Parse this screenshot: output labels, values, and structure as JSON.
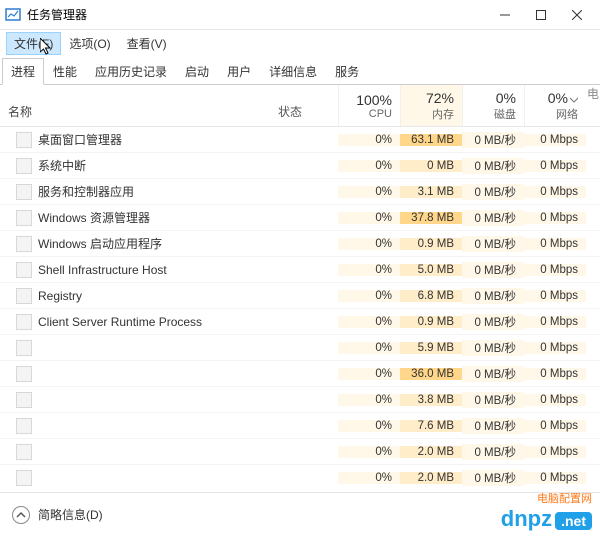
{
  "window": {
    "title": "任务管理器",
    "menus": {
      "file": "文件(F)",
      "options": "选项(O)",
      "view": "查看(V)"
    },
    "tabs": [
      "进程",
      "性能",
      "应用历史记录",
      "启动",
      "用户",
      "详细信息",
      "服务"
    ],
    "headers": {
      "name": "名称",
      "status": "状态",
      "cpu_pct": "100%",
      "cpu_lbl": "CPU",
      "mem_pct": "72%",
      "mem_lbl": "内存",
      "disk_pct": "0%",
      "disk_lbl": "磁盘",
      "net_pct": "0%",
      "net_lbl": "网络",
      "extra": "电"
    }
  },
  "processes": [
    {
      "name": "桌面窗口管理器",
      "cpu": "0%",
      "mem": "63.1 MB",
      "mem_hot": true,
      "disk": "0 MB/秒",
      "net": "0 Mbps"
    },
    {
      "name": "系统中断",
      "cpu": "0%",
      "mem": "0 MB",
      "mem_hot": false,
      "disk": "0 MB/秒",
      "net": "0 Mbps"
    },
    {
      "name": "服务和控制器应用",
      "cpu": "0%",
      "mem": "3.1 MB",
      "mem_hot": false,
      "disk": "0 MB/秒",
      "net": "0 Mbps"
    },
    {
      "name": "Windows 资源管理器",
      "cpu": "0%",
      "mem": "37.8 MB",
      "mem_hot": true,
      "disk": "0 MB/秒",
      "net": "0 Mbps"
    },
    {
      "name": "Windows 启动应用程序",
      "cpu": "0%",
      "mem": "0.9 MB",
      "mem_hot": false,
      "disk": "0 MB/秒",
      "net": "0 Mbps"
    },
    {
      "name": "Shell Infrastructure Host",
      "cpu": "0%",
      "mem": "5.0 MB",
      "mem_hot": false,
      "disk": "0 MB/秒",
      "net": "0 Mbps"
    },
    {
      "name": "Registry",
      "cpu": "0%",
      "mem": "6.8 MB",
      "mem_hot": false,
      "disk": "0 MB/秒",
      "net": "0 Mbps"
    },
    {
      "name": "Client Server Runtime Process",
      "cpu": "0%",
      "mem": "0.9 MB",
      "mem_hot": false,
      "disk": "0 MB/秒",
      "net": "0 Mbps"
    },
    {
      "name": "",
      "cpu": "0%",
      "mem": "5.9 MB",
      "mem_hot": false,
      "disk": "0 MB/秒",
      "net": "0 Mbps"
    },
    {
      "name": "",
      "cpu": "0%",
      "mem": "36.0 MB",
      "mem_hot": true,
      "disk": "0 MB/秒",
      "net": "0 Mbps"
    },
    {
      "name": "",
      "cpu": "0%",
      "mem": "3.8 MB",
      "mem_hot": false,
      "disk": "0 MB/秒",
      "net": "0 Mbps"
    },
    {
      "name": "",
      "cpu": "0%",
      "mem": "7.6 MB",
      "mem_hot": false,
      "disk": "0 MB/秒",
      "net": "0 Mbps"
    },
    {
      "name": "",
      "cpu": "0%",
      "mem": "2.0 MB",
      "mem_hot": false,
      "disk": "0 MB/秒",
      "net": "0 Mbps"
    },
    {
      "name": "",
      "cpu": "0%",
      "mem": "2.0 MB",
      "mem_hot": false,
      "disk": "0 MB/秒",
      "net": "0 Mbps"
    }
  ],
  "footer": {
    "fewer_details": "简略信息(D)"
  },
  "watermark": {
    "zh": "电脑配置网",
    "main": "dnpz",
    "suffix": ".net"
  }
}
